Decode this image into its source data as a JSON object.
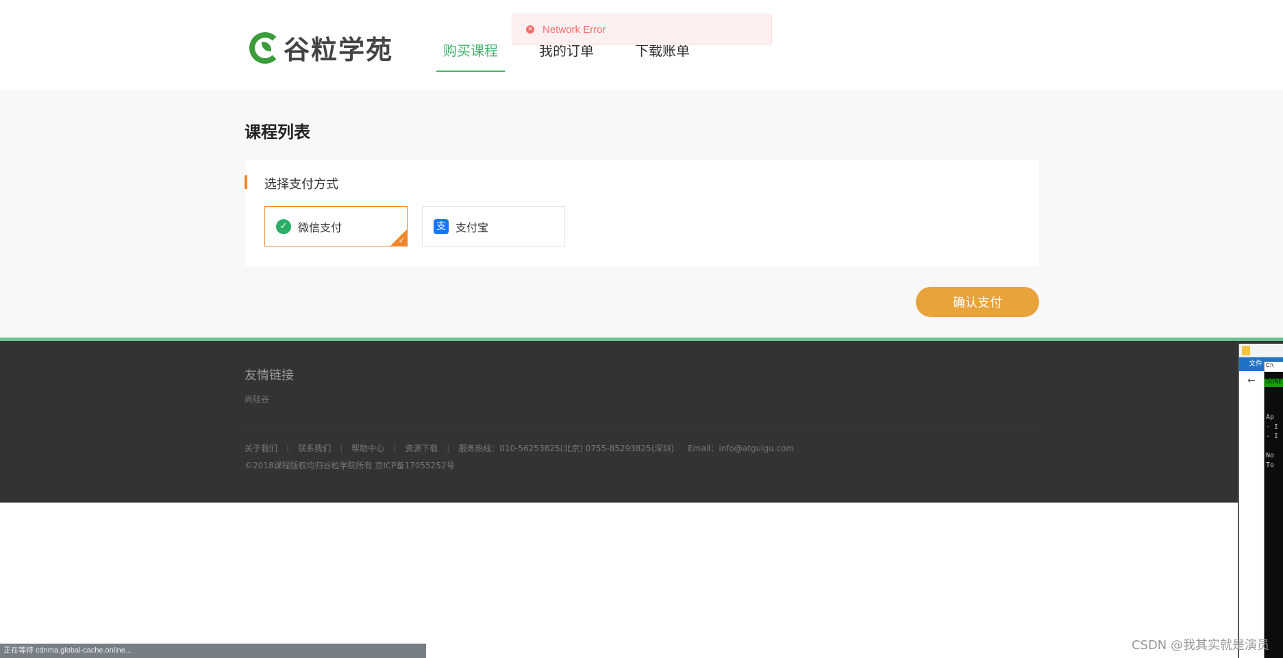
{
  "header": {
    "logo_text": "谷粒学苑",
    "nav": [
      {
        "label": "购买课程",
        "active": true
      },
      {
        "label": "我的订单",
        "active": false
      },
      {
        "label": "下载账单",
        "active": false
      }
    ]
  },
  "toast": {
    "text": "Network Error",
    "icon": "close-circle-icon",
    "color": "#f56c6c"
  },
  "main": {
    "page_title": "课程列表",
    "pay_section_title": "选择支付方式",
    "pay_options": [
      {
        "label": "微信支付",
        "icon": "wechat-icon",
        "selected": true
      },
      {
        "label": "支付宝",
        "icon": "alipay-icon",
        "selected": false
      }
    ],
    "confirm_button": "确认支付",
    "accent": "#f0862b",
    "button_color": "#e8a33c"
  },
  "footer": {
    "title": "友情链接",
    "link": "尚硅谷",
    "links": [
      "关于我们",
      "联系我们",
      "帮助中心",
      "资源下载"
    ],
    "hotline": "服务热线：010-56253825(北京) 0755-85293825(深圳)",
    "email": "Email：info@atguigu.com",
    "copyright": "©2018课程版权均归谷粒学院所有 京ICP备17055252号",
    "brand_color": "#6cc093"
  },
  "status_bar": {
    "text": "正在等待 cdnma.global-cache.online..."
  },
  "watermark": "CSDN @我其实就是演员",
  "side_window": {
    "menu": "文件",
    "cmd_title": "C:\\",
    "done_label": "DONE",
    "cmd_text": "Ap\n- I\n- I\n\nNo\nTo"
  }
}
